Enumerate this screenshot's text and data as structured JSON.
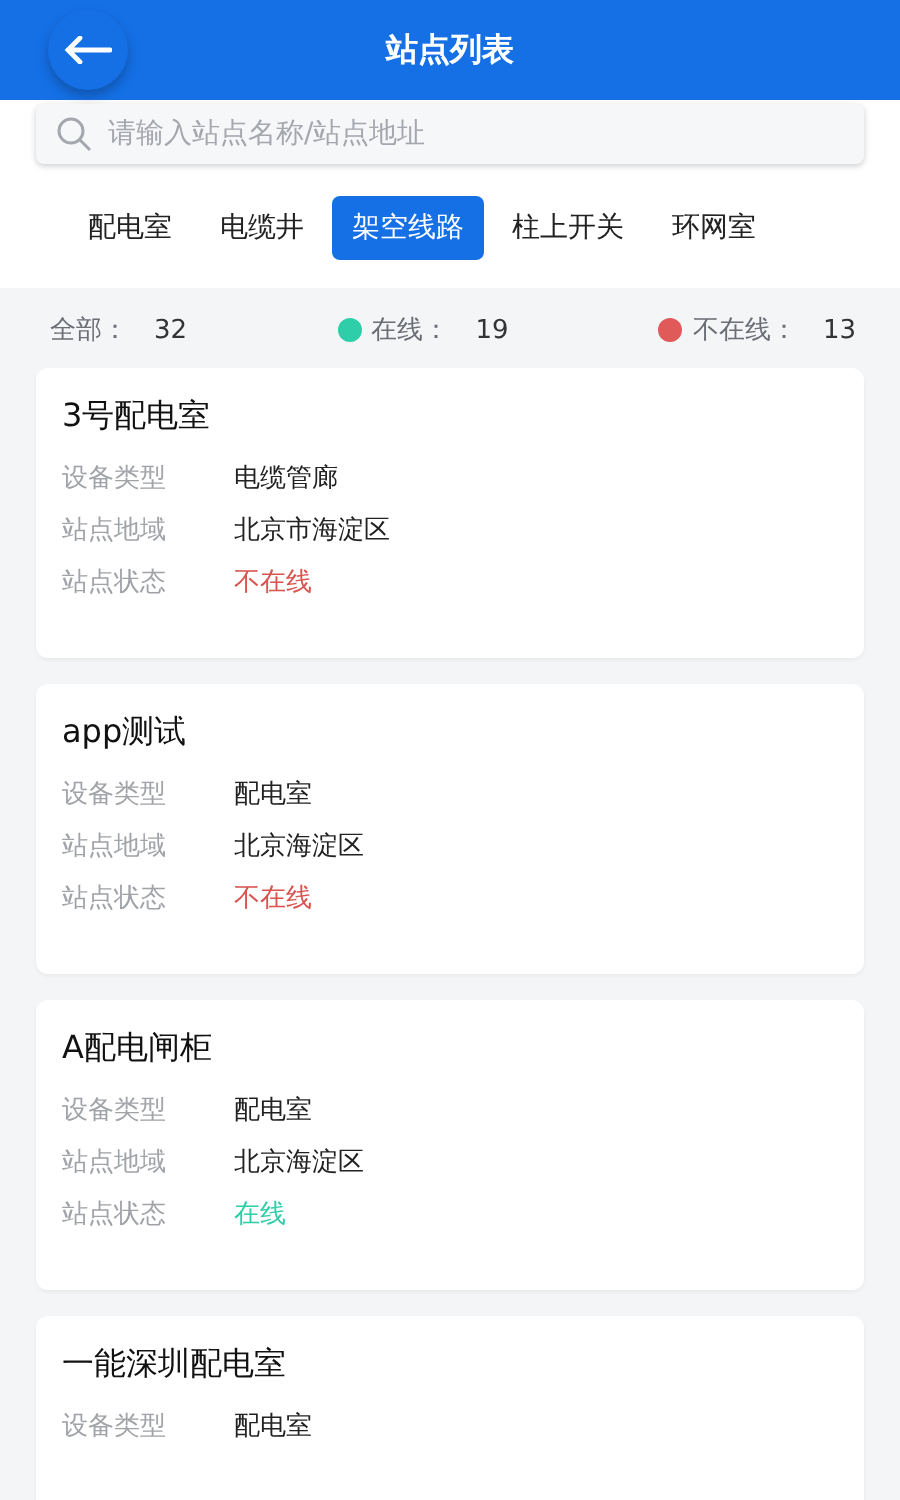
{
  "header": {
    "title": "站点列表"
  },
  "search": {
    "placeholder": "请输入站点名称/站点地址"
  },
  "tabs": [
    {
      "label": "配电室",
      "selected": false
    },
    {
      "label": "电缆井",
      "selected": false
    },
    {
      "label": "架空线路",
      "selected": true
    },
    {
      "label": "柱上开关",
      "selected": false
    },
    {
      "label": "环网室",
      "selected": false
    }
  ],
  "summary": [
    {
      "label": "全部：",
      "count": "32"
    },
    {
      "label": "在线：",
      "count": "19",
      "color": "#2ecfa8"
    },
    {
      "label": "不在线：",
      "count": "13",
      "color": "#e05a5a"
    }
  ],
  "stations": [
    {
      "name": "3号配电室",
      "fields": [
        {
          "label": "设备类型",
          "value": "电缆管廊"
        },
        {
          "label": "站点地域",
          "value": "北京市海淀区"
        },
        {
          "label": "站点状态",
          "value": "不在线",
          "online": false
        }
      ]
    },
    {
      "name": "app测试",
      "fields": [
        {
          "label": "设备类型",
          "value": "配电室"
        },
        {
          "label": "站点地域",
          "value": "北京海淀区"
        },
        {
          "label": "站点状态",
          "value": "不在线",
          "online": false
        }
      ]
    },
    {
      "name": "A配电闸柜",
      "fields": [
        {
          "label": "设备类型",
          "value": "配电室"
        },
        {
          "label": "站点地域",
          "value": "北京海淀区"
        },
        {
          "label": "站点状态",
          "value": "在线",
          "online": true
        }
      ]
    },
    {
      "name": "一能深圳配电室",
      "fields": [
        {
          "label": "设备类型",
          "value": "配电室"
        }
      ]
    }
  ]
}
